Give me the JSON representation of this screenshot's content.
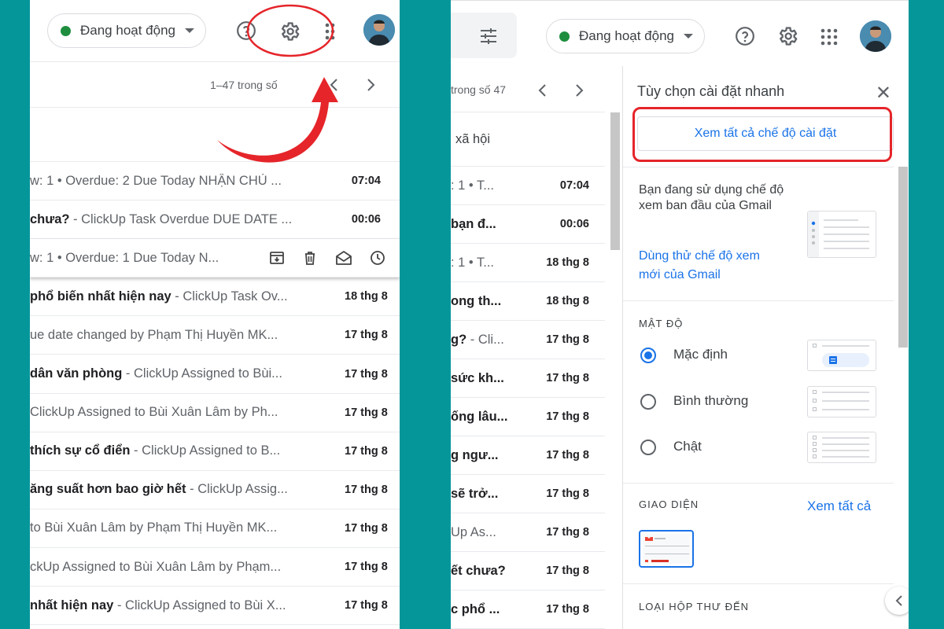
{
  "header": {
    "status_label": "Đang hoạt động"
  },
  "left": {
    "pager": "1–47 trong số",
    "rows": [
      {
        "bold": "",
        "snippet": "w: 1 • Overdue: 2 Due Today NHẬN CHỦ ...",
        "time": "07:04"
      },
      {
        "bold": "chưa?",
        "snippet": " - ClickUp Task Overdue DUE DATE ...",
        "time": "00:06"
      },
      {
        "bold": "",
        "snippet": "w: 1 • Overdue: 1 Due Today N...",
        "time": ""
      },
      {
        "bold": "phổ biến nhất hiện nay",
        "snippet": " - ClickUp Task Ov...",
        "time": "18 thg 8"
      },
      {
        "bold": "",
        "snippet": "ue date changed by Phạm Thị Huyền MK...",
        "time": "17 thg 8"
      },
      {
        "bold": " dân văn phòng",
        "snippet": " - ClickUp Assigned to Bùi...",
        "time": "17 thg 8"
      },
      {
        "bold": "",
        "snippet": "ClickUp Assigned to Bùi Xuân Lâm by Ph...",
        "time": "17 thg 8"
      },
      {
        "bold": "thích sự cổ điển",
        "snippet": " - ClickUp Assigned to B...",
        "time": "17 thg 8"
      },
      {
        "bold": "ăng suất hơn bao giờ hết",
        "snippet": " - ClickUp Assig...",
        "time": "17 thg 8"
      },
      {
        "bold": "",
        "snippet": "to Bùi Xuân Lâm by Phạm Thị Huyền MK...",
        "time": "17 thg 8"
      },
      {
        "bold": "",
        "snippet": "ckUp Assigned to Bùi Xuân Lâm by Phạm...",
        "time": "17 thg 8"
      },
      {
        "bold": "nhất hiện nay",
        "snippet": " - ClickUp Assigned to Bùi X...",
        "time": "17 thg 8"
      }
    ]
  },
  "right": {
    "pager": "trong số 47",
    "first_row": "xã hội",
    "rows": [
      {
        "bold": "",
        "snippet": ": 1 • T...",
        "time": "07:04"
      },
      {
        "bold": "bạn đ...",
        "snippet": "",
        "time": "00:06"
      },
      {
        "bold": "",
        "snippet": ": 1 • T...",
        "time": "18 thg 8"
      },
      {
        "bold": "ong th...",
        "snippet": "",
        "time": "18 thg 8"
      },
      {
        "bold": "g?",
        "snippet": " - Cli...",
        "time": "17 thg 8"
      },
      {
        "bold": "sức kh...",
        "snippet": "",
        "time": "17 thg 8"
      },
      {
        "bold": "ống lâu...",
        "snippet": "",
        "time": "17 thg 8"
      },
      {
        "bold": "g ngư...",
        "snippet": "",
        "time": "17 thg 8"
      },
      {
        "bold": " sẽ trở...",
        "snippet": "",
        "time": "17 thg 8"
      },
      {
        "bold": "",
        "snippet": "Up As...",
        "time": "17 thg 8"
      },
      {
        "bold": "ết chưa?",
        "snippet": "",
        "time": "17 thg 8"
      },
      {
        "bold": "c phổ ...",
        "snippet": "",
        "time": "17 thg 8"
      }
    ]
  },
  "quick_settings": {
    "title": "Tùy chọn cài đặt nhanh",
    "see_all_settings": "Xem tất cả chế độ cài đặt",
    "view_desc": "Bạn đang sử dụng chế độ xem ban đầu của Gmail",
    "try_new_view": "Dùng thử chế độ xem mới của Gmail",
    "density_header": "MẬT ĐỘ",
    "density_options": [
      "Mặc định",
      "Bình thường",
      "Chật"
    ],
    "density_selected": "Mặc định",
    "theme_header": "GIAO DIỆN",
    "theme_see_all": "Xem tất cả",
    "inbox_type_header": "LOẠI HỘP THƯ ĐẾN"
  },
  "annotations": {
    "highlight_color": "#e5252a"
  }
}
